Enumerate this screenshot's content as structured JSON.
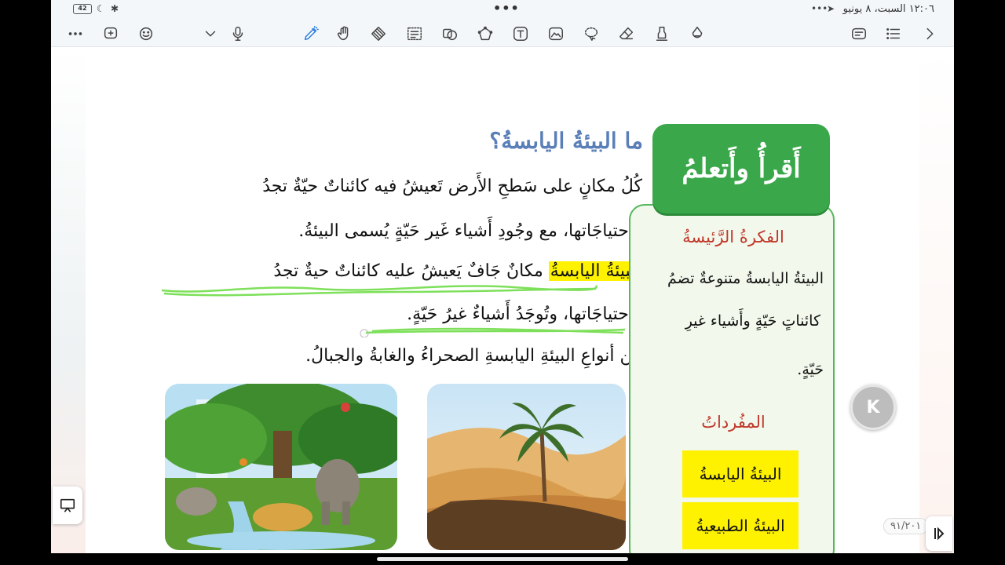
{
  "status": {
    "battery": "42",
    "clock": "١٢:٠٦ السبت، ٨ يونيو",
    "dots": "•••"
  },
  "toolbar": {
    "tools": [
      "more",
      "add-page",
      "sticker",
      "dropdown",
      "mic",
      "laser-pen",
      "hand",
      "eraser-grid",
      "text-select",
      "shape",
      "lasso-shape",
      "text-box",
      "image",
      "lasso",
      "eraser",
      "highlighter",
      "fill"
    ],
    "active_tool": "laser-pen",
    "right_tools": [
      "text-mode",
      "list",
      "forward"
    ]
  },
  "content": {
    "title": "ما البيئةُ اليابسةُ؟",
    "line1": "كُلُ مكانٍ على سَطحِ الأَرض تَعيشُ فيه كائناتٌ حيّةٌ تجدُ",
    "line2": "فيها إحتياجَاتها،  مع وجُودِ أَشياء غَير حَيّةٍ يُسمى البيئةُ.",
    "line3_highlight": "البيئةُ اليابسةُ",
    "line3_rest": "مكانٌ جَافٌ يَعيشُ عليه كائناتٌ حيةٌ تجدُ",
    "line4": "فيها إحتياجَاتها، وتُوجَدُ أَشياءٌ غيرُ حَيّةٍ.",
    "line5": "من أنواعِ البيئةِ اليابسةِ الصحراءُ والغابةُ والجبالُ."
  },
  "panel": {
    "tag": "أَقرأُ وأَتعلمُ",
    "idea_heading": "الفكرةُ الرَّئيسةُ",
    "idea_line1": "البيئةُ اليابسةُ متنوعةٌ تضمُ",
    "idea_line2": "كائناتٍ حَيّةٍ وأَشياء غيرِ",
    "idea_line3": "حَيّةٍ.",
    "vocab_heading": "المفُرداتُ",
    "vocab": [
      "البيئةُ اليابسةُ",
      "البيئةُ الطبيعيةُ"
    ]
  },
  "images": {
    "forest": "forest-illustration",
    "desert": "desert-photo"
  },
  "floating": {
    "assist_label": "K",
    "page_number": "٩١/٢٠١"
  },
  "colors": {
    "title_blue": "#5a7fb8",
    "highlight": "#fff200",
    "green": "#3aa84a",
    "red_heading": "#c0392b",
    "pen_green": "#7ee05a"
  }
}
